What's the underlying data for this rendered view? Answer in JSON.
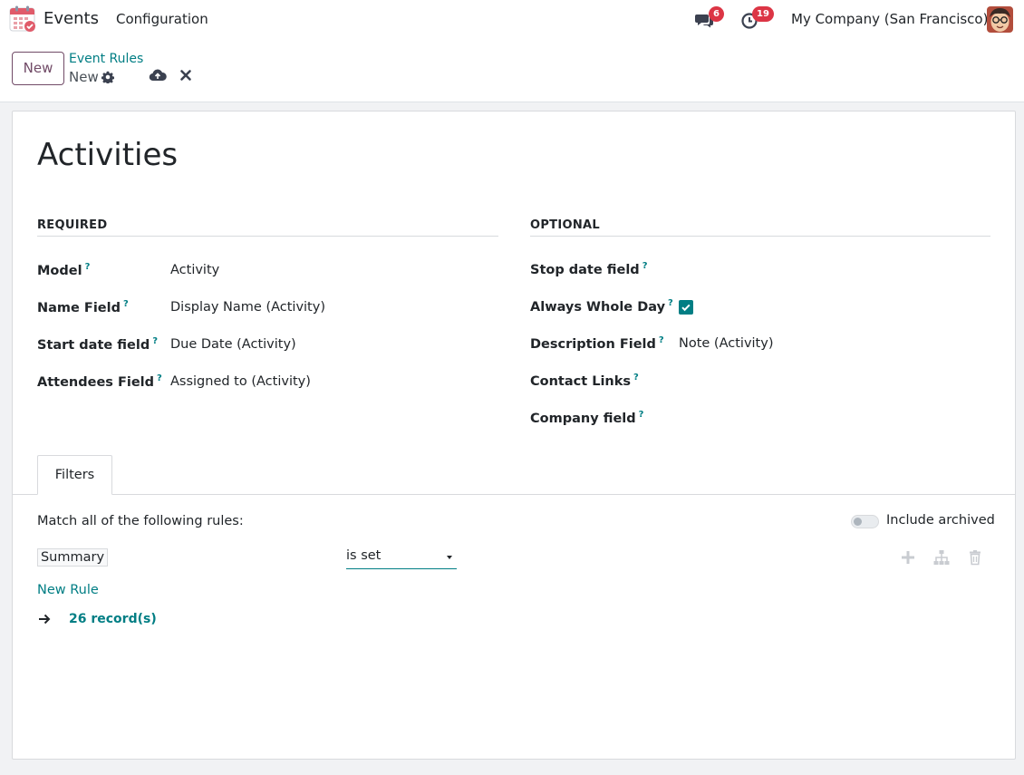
{
  "navbar": {
    "app_name": "Events",
    "menu_configuration": "Configuration",
    "messages_count": "6",
    "activities_count": "19",
    "company": "My Company (San Francisco)"
  },
  "control_panel": {
    "new_label": "New",
    "breadcrumb_parent": "Event Rules",
    "breadcrumb_current": "New"
  },
  "form": {
    "title": "Activities",
    "required_group": "REQUIRED",
    "optional_group": "OPTIONAL",
    "required_fields": [
      {
        "label": "Model",
        "value": "Activity"
      },
      {
        "label": "Name Field",
        "value": "Display Name (Activity)"
      },
      {
        "label": "Start date field",
        "value": "Due Date (Activity)"
      },
      {
        "label": "Attendees Field",
        "value": "Assigned to (Activity)"
      }
    ],
    "optional_fields": [
      {
        "label": "Stop date field",
        "value": ""
      },
      {
        "label": "Always Whole Day",
        "value": "checked"
      },
      {
        "label": "Description Field",
        "value": "Note (Activity)"
      },
      {
        "label": "Contact Links",
        "value": ""
      },
      {
        "label": "Company field",
        "value": ""
      }
    ],
    "help_marker": "?"
  },
  "filters": {
    "tab_label": "Filters",
    "match_text": "Match all of the following rules:",
    "include_archived": "Include archived",
    "include_archived_on": false,
    "rule_field": "Summary",
    "rule_operator": "is set",
    "new_rule": "New Rule",
    "records": "26 record(s)"
  },
  "colors": {
    "accent": "#017e84",
    "brand": "#714b67",
    "badge": "#dc3545"
  }
}
